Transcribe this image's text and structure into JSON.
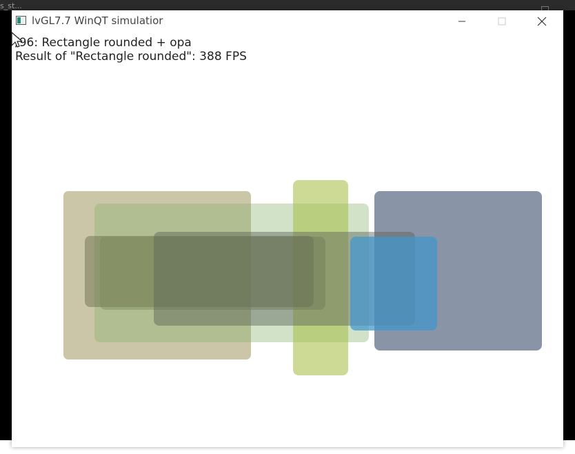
{
  "background": {
    "partial_text": "s_st..."
  },
  "window": {
    "title": "lvGL7.7 WinQT simulatior",
    "buttons": {
      "minimize": "—",
      "maximize": "□",
      "close": "✕"
    }
  },
  "canvas": {
    "line1": "/96: Rectangle rounded + opa",
    "line2": "Result of \"Rectangle rounded\": 388 FPS"
  },
  "colors": {
    "rect_olive": "#9e985e",
    "rect_green_light": "#87b26e",
    "rect_yellow_green": "#aac250",
    "rect_slate": "#50607c",
    "rect_blue": "#4196cd"
  }
}
